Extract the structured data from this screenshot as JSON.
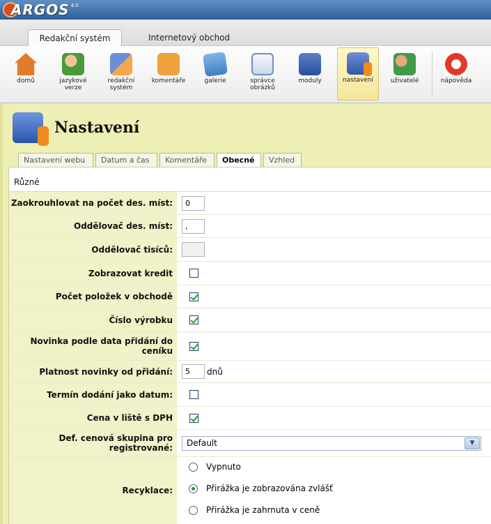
{
  "app": {
    "logo_text": "ARGOS",
    "logo_sup": "4.0"
  },
  "main_tabs": [
    {
      "label": "Redakční systém",
      "active": true
    },
    {
      "label": "Internetový obchod",
      "active": false
    }
  ],
  "toolbar": [
    {
      "line1": "domů",
      "line2": "",
      "icon": "home-icon"
    },
    {
      "line1": "jazykové",
      "line2": "verze",
      "icon": "language-icon"
    },
    {
      "line1": "redakční",
      "line2": "systém",
      "icon": "edit-icon"
    },
    {
      "line1": "komentáře",
      "line2": "",
      "icon": "comment-icon"
    },
    {
      "line1": "galerie",
      "line2": "",
      "icon": "gallery-icon"
    },
    {
      "line1": "správce",
      "line2": "obrázků",
      "icon": "images-icon"
    },
    {
      "line1": "moduly",
      "line2": "",
      "icon": "modules-icon"
    },
    {
      "line1": "nastavení",
      "line2": "",
      "icon": "settings-icon",
      "active": true
    },
    {
      "line1": "uživatelé",
      "line2": "",
      "icon": "users-icon"
    },
    {
      "line1": "nápověda",
      "line2": "",
      "icon": "help-icon"
    }
  ],
  "page": {
    "title": "Nastavení"
  },
  "sub_tabs": [
    {
      "label": "Nastavení webu"
    },
    {
      "label": "Datum a čas"
    },
    {
      "label": "Komentáře"
    },
    {
      "label": "Obecné",
      "active": true
    },
    {
      "label": "Vzhled"
    }
  ],
  "section": {
    "title": "Různé"
  },
  "settings": {
    "round_label": "Zaokrouhlovat na počet des. míst:",
    "round_value": "0",
    "decsep_label": "Oddělovač des. míst:",
    "decsep_value": ",",
    "thousep_label": "Oddělovač tisíců:",
    "thousep_value": "",
    "credit_label": "Zobrazovat kredit",
    "credit_checked": false,
    "count_label": "Počet položek v obchodě",
    "count_checked": true,
    "product_no_label": "Číslo výrobku",
    "product_no_checked": true,
    "novelty_label": "Novinka podle data přidání do ceníku",
    "novelty_checked": true,
    "validity_label": "Platnost novinky od přidání:",
    "validity_value": "5",
    "validity_unit": "dnů",
    "delivery_label": "Termín dodání jako datum:",
    "delivery_checked": false,
    "vat_label": "Cena v liště s DPH",
    "vat_checked": true,
    "pricegroup_label": "Def. cenová skupina pro registrované:",
    "pricegroup_value": "Default",
    "recycle_label": "Recyklace:",
    "recycle_options": [
      {
        "label": "Vypnuto",
        "selected": false
      },
      {
        "label": "Přirážka je zobrazována zvlášť",
        "selected": true
      },
      {
        "label": "Přirážka je zahrnuta v ceně",
        "selected": false
      }
    ]
  }
}
